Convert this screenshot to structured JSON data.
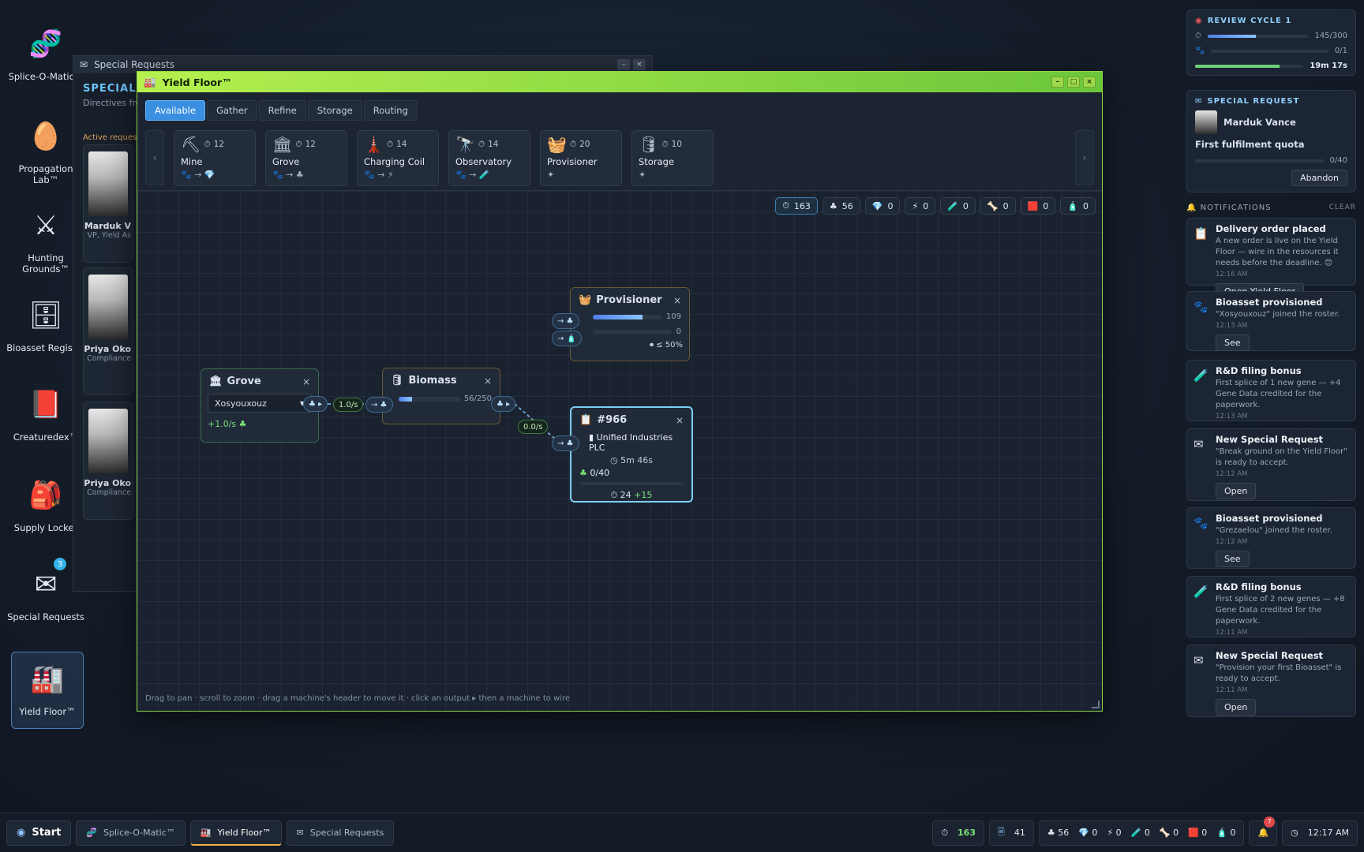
{
  "desktop": {
    "icons": [
      {
        "label": "Splice-O-Matic™",
        "emoji": "🧬"
      },
      {
        "label": "Propagation Lab™",
        "emoji": "🥚"
      },
      {
        "label": "Hunting Grounds™",
        "emoji": "⚔"
      },
      {
        "label": "Bioasset Registry",
        "emoji": "🗄"
      },
      {
        "label": "Creaturedex™",
        "emoji": "📕"
      },
      {
        "label": "Supply Locker",
        "emoji": "🎒"
      },
      {
        "label": "Special Requests",
        "emoji": "✉",
        "badge": "3"
      },
      {
        "label": "Yield Floor™",
        "emoji": "🏭"
      }
    ]
  },
  "special_requests_window": {
    "title": "Special Requests",
    "heading": "SPECIAL",
    "subtitle": "Directives fro",
    "active_label": "Active request",
    "cards": [
      {
        "name": "Marduk V",
        "role": "VP, Yield As"
      },
      {
        "name": "Priya Oko",
        "role": "Compliance"
      },
      {
        "name": "Priya Oko",
        "role": "Compliance"
      }
    ]
  },
  "yield_floor": {
    "title": "Yield Floor™",
    "tabs": [
      "Available",
      "Gather",
      "Refine",
      "Storage",
      "Routing"
    ],
    "active_tab": "Available",
    "machines": [
      {
        "name": "Mine",
        "emoji": "⛏",
        "cost": "12",
        "io": "🐾 → 💎"
      },
      {
        "name": "Grove",
        "emoji": "🏛",
        "cost": "12",
        "io": "🐾 → ♣"
      },
      {
        "name": "Charging Coil",
        "emoji": "🗼",
        "cost": "14",
        "io": "🐾 → ⚡"
      },
      {
        "name": "Observatory",
        "emoji": "🔭",
        "cost": "14",
        "io": "🐾 → 🧪"
      },
      {
        "name": "Provisioner",
        "emoji": "🧺",
        "cost": "20",
        "io": "✦"
      },
      {
        "name": "Storage",
        "emoji": "🛢",
        "cost": "10",
        "io": "✦"
      }
    ],
    "counters": [
      {
        "icon": "⏱",
        "value": "163"
      },
      {
        "icon": "♣",
        "value": "56"
      },
      {
        "icon": "💎",
        "value": "0"
      },
      {
        "icon": "⚡",
        "value": "0"
      },
      {
        "icon": "🧪",
        "value": "0"
      },
      {
        "icon": "🦴",
        "value": "0"
      },
      {
        "icon": "🟥",
        "value": "0"
      },
      {
        "icon": "🧴",
        "value": "0"
      }
    ],
    "nodes": {
      "grove": {
        "title": "Grove",
        "select": "Xosyouxouz",
        "rate": "+1.0/s ♣"
      },
      "biomass": {
        "title": "Biomass",
        "fill": "56/250",
        "fill_pct": 22
      },
      "provisioner": {
        "title": "Provisioner",
        "bar1_value": "109",
        "bar1_pct": 72,
        "bar2_value": "0",
        "bar2_pct": 0,
        "threshold": "≤ 50%"
      },
      "order": {
        "title": "#966",
        "client": "Unified Industries PLC",
        "timer": "5m 46s",
        "progress": "0/40",
        "progress_pct": 0,
        "reward_base": "24",
        "reward_bonus": "+15"
      }
    },
    "flows": [
      "1.0/s",
      "0.0/s"
    ],
    "hint": "Drag to pan · scroll to zoom · drag a machine's header to move it · click an output ▸ then a machine to wire"
  },
  "right_panel": {
    "review": {
      "title": "REVIEW CYCLE 1",
      "row1": "145/300",
      "row1_pct": 48,
      "row2": "0/1",
      "row2_pct": 0,
      "row3": "19m 17s",
      "row3_pct": 78
    },
    "special": {
      "title": "SPECIAL REQUEST",
      "person": "Marduk Vance",
      "task": "First fulfilment quota",
      "progress": "0/40",
      "button": "Abandon"
    },
    "notifications_label": "NOTIFICATIONS",
    "clear_label": "CLEAR",
    "notifications": [
      {
        "icon": "📋",
        "title": "Delivery order placed",
        "body": "A new order is live on the Yield Floor — wire in the resources it needs before the deadline. 😊",
        "time": "12:16 AM",
        "button": "Open Yield Floor"
      },
      {
        "icon": "🐾",
        "title": "Bioasset provisioned",
        "body": "\"Xosyouxouz\" joined the roster.",
        "time": "12:13 AM",
        "button": "See"
      },
      {
        "icon": "🧪",
        "title": "R&D filing bonus",
        "body": "First splice of 1 new gene — +4 Gene Data credited for the paperwork.",
        "time": "12:13 AM",
        "button": ""
      },
      {
        "icon": "✉",
        "title": "New Special Request",
        "body": "\"Break ground on the Yield Floor\" is ready to accept.",
        "time": "12:12 AM",
        "button": "Open"
      },
      {
        "icon": "🐾",
        "title": "Bioasset provisioned",
        "body": "\"Grezaelou\" joined the roster.",
        "time": "12:12 AM",
        "button": "See"
      },
      {
        "icon": "🧪",
        "title": "R&D filing bonus",
        "body": "First splice of 2 new genes — +8 Gene Data credited for the paperwork.",
        "time": "12:11 AM",
        "button": ""
      },
      {
        "icon": "✉",
        "title": "New Special Request",
        "body": "\"Provision your first Bioasset\" is ready to accept.",
        "time": "12:11 AM",
        "button": "Open"
      }
    ]
  },
  "taskbar": {
    "start": "Start",
    "windows": [
      {
        "label": "Splice-O-Matic™",
        "emoji": "🧬"
      },
      {
        "label": "Yield Floor™",
        "emoji": "🏭"
      },
      {
        "label": "Special Requests",
        "emoji": "✉"
      }
    ],
    "tray": [
      {
        "icon": "⏱",
        "value": "163"
      },
      {
        "icon": "🗎",
        "value": "41"
      }
    ],
    "resources": [
      {
        "icon": "♣",
        "value": "56"
      },
      {
        "icon": "💎",
        "value": "0"
      },
      {
        "icon": "⚡",
        "value": "0"
      },
      {
        "icon": "🧪",
        "value": "0"
      },
      {
        "icon": "🦴",
        "value": "0"
      },
      {
        "icon": "🟥",
        "value": "0"
      },
      {
        "icon": "🧴",
        "value": "0"
      }
    ],
    "bell_count": "7",
    "clock": "12:17 AM"
  }
}
